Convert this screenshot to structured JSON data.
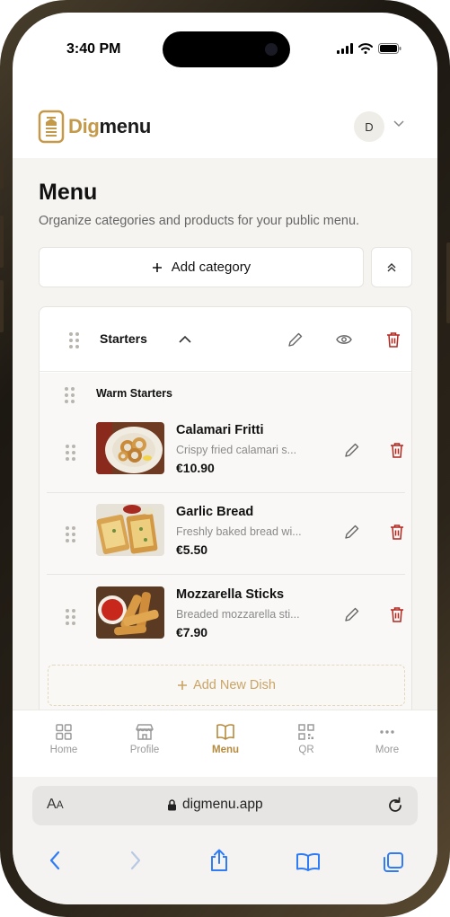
{
  "status_bar": {
    "time": "3:40 PM"
  },
  "header": {
    "logo_part1": "Dig",
    "logo_part2": "menu",
    "avatar_initial": "D"
  },
  "page": {
    "title": "Menu",
    "subtitle": "Organize categories and products for your public menu.",
    "add_category_label": "Add category"
  },
  "category": {
    "name": "Starters",
    "subcategory": {
      "name": "Warm Starters",
      "dishes": [
        {
          "name": "Calamari Fritti",
          "description": "Crispy fried calamari s...",
          "price": "€10.90"
        },
        {
          "name": "Garlic Bread",
          "description": "Freshly baked bread wi...",
          "price": "€5.50"
        },
        {
          "name": "Mozzarella Sticks",
          "description": "Breaded mozzarella sti...",
          "price": "€7.90"
        }
      ],
      "add_dish_label": "Add New Dish"
    }
  },
  "tabbar": {
    "items": [
      {
        "label": "Home",
        "icon": "grid-icon"
      },
      {
        "label": "Profile",
        "icon": "store-icon"
      },
      {
        "label": "Menu",
        "icon": "book-icon",
        "active": true
      },
      {
        "label": "QR",
        "icon": "qr-icon"
      },
      {
        "label": "More",
        "icon": "more-dots-icon"
      }
    ]
  },
  "browser": {
    "aa_big": "A",
    "aa_small": "A",
    "url": "digmenu.app"
  },
  "colors": {
    "accent": "#c49a4a",
    "danger": "#b3261e",
    "background": "#f5f4f1"
  }
}
